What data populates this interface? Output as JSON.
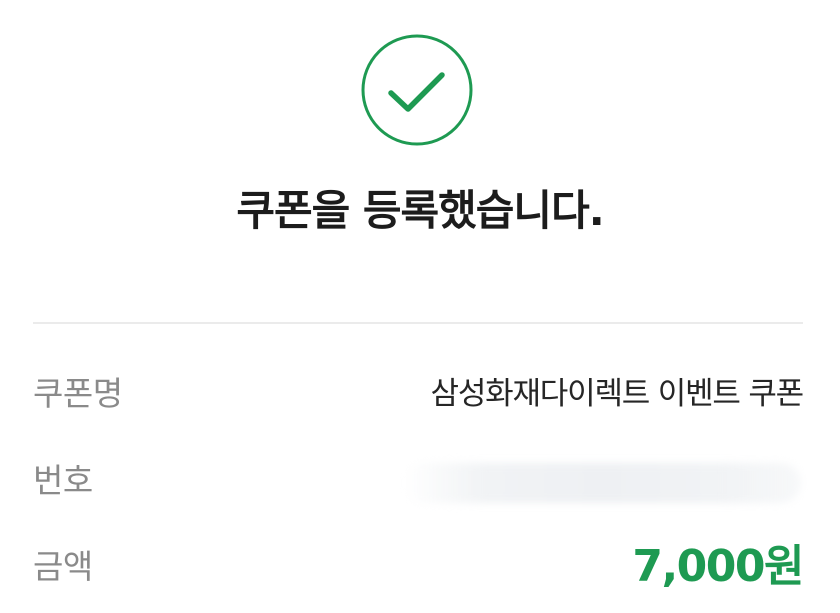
{
  "dialog": {
    "title": "쿠폰을 등록했습니다.",
    "icon": "check-circle-icon",
    "accent_color": "#1e9a52"
  },
  "details": {
    "name_label": "쿠폰명",
    "name_value": "삼성화재다이렉트 이벤트 쿠폰",
    "number_label": "번호",
    "number_value": "",
    "amount_label": "금액",
    "amount_value": "7,000원"
  }
}
